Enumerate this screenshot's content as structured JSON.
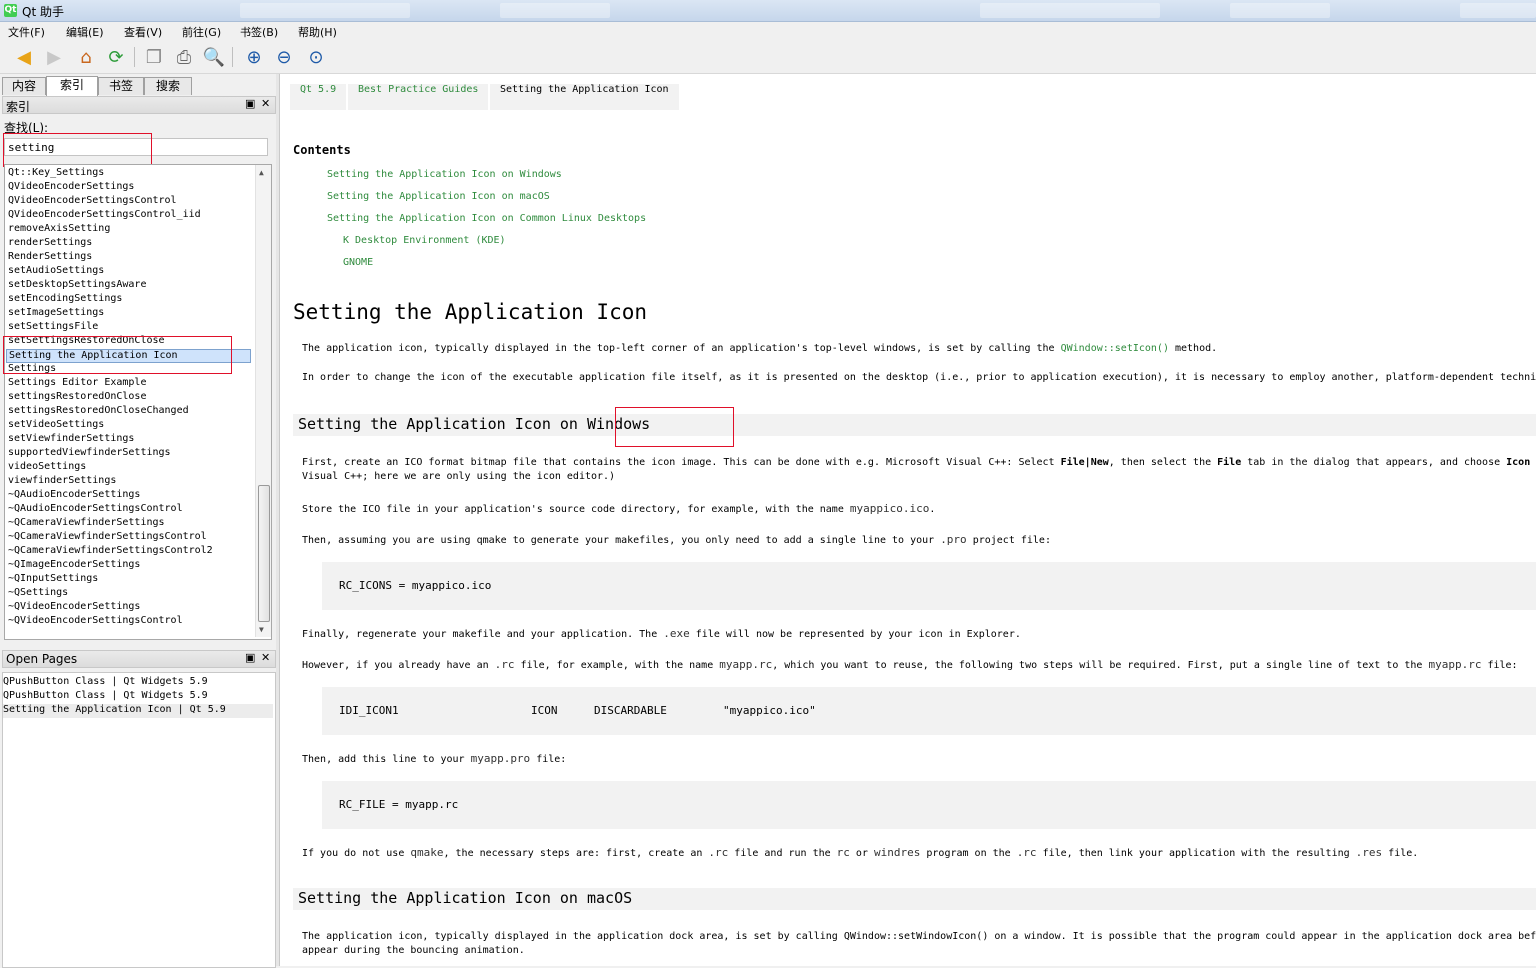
{
  "window": {
    "title": "Qt 助手",
    "app_icon": "qt-logo"
  },
  "menu": [
    "文件(F)",
    "编辑(E)",
    "查看(V)",
    "前往(G)",
    "书签(B)",
    "帮助(H)"
  ],
  "toolbar": [
    "back-icon",
    "forward-icon",
    "home-icon",
    "sync-icon",
    "copy-icon",
    "print-icon",
    "find-icon",
    "zoom-in-icon",
    "zoom-out-icon",
    "zoom-reset-icon"
  ],
  "left": {
    "tabs": [
      "内容",
      "索引",
      "书签",
      "搜索"
    ],
    "active_tab": "索引",
    "index_panel_title": "索引",
    "find_label": "查找(L):",
    "search_value": "setting",
    "index_items": [
      "Qt::Key_Settings",
      "QVideoEncoderSettings",
      "QVideoEncoderSettingsControl",
      "QVideoEncoderSettingsControl_iid",
      "removeAxisSetting",
      "renderSettings",
      "RenderSettings",
      "setAudioSettings",
      "setDesktopSettingsAware",
      "setEncodingSettings",
      "setImageSettings",
      "setSettingsFile",
      "setSettingsRestoredOnClose",
      "Setting the Application Icon",
      "Settings",
      "Settings Editor Example",
      "settingsRestoredOnClose",
      "settingsRestoredOnCloseChanged",
      "setVideoSettings",
      "setViewfinderSettings",
      "supportedViewfinderSettings",
      "videoSettings",
      "viewfinderSettings",
      "~QAudioEncoderSettings",
      "~QAudioEncoderSettingsControl",
      "~QCameraViewfinderSettings",
      "~QCameraViewfinderSettingsControl",
      "~QCameraViewfinderSettingsControl2",
      "~QImageEncoderSettings",
      "~QInputSettings",
      "~QSettings",
      "~QVideoEncoderSettings",
      "~QVideoEncoderSettingsControl"
    ],
    "selected_index": 13,
    "open_pages_title": "Open Pages",
    "open_pages": [
      "QPushButton Class | Qt Widgets 5.9",
      "QPushButton Class | Qt Widgets 5.9",
      "Setting the Application Icon | Qt 5.9"
    ]
  },
  "doc": {
    "breadcrumbs": [
      "Qt 5.9",
      "Best Practice Guides",
      "Setting the Application Icon"
    ],
    "contents_heading": "Contents",
    "toc": [
      "Setting the Application Icon on Windows",
      "Setting the Application Icon on macOS",
      "Setting the Application Icon on Common Linux Desktops",
      "K Desktop Environment (KDE)",
      "GNOME"
    ],
    "title": "Setting the Application Icon",
    "p1": {
      "a": "The application icon, typically displayed in the top-left corner of an application's top-level windows, is set by calling the ",
      "link": "QWindow::setIcon()",
      "b": " method."
    },
    "p2": "In order to change the icon of the executable application file itself, as it is presented on the desktop (i.e., prior to application execution), it is necessary to employ another, platform-dependent technique.",
    "h_windows": {
      "a": "Setting the Application Icon on ",
      "b": "Windows"
    },
    "p3": {
      "a": "First, create an ICO format bitmap file that contains the icon image. This can be done with e.g. Microsoft Visual C++: Select ",
      "b1": "File|New",
      "c": ", then select the ",
      "b2": "File",
      "d": " tab in the dialog that appears, and choose ",
      "b3": "Icon",
      "line2": "Visual C++; here we are only using the icon editor.)"
    },
    "p4": {
      "a": "Store the ICO file in your application's source code directory, for example, with the name ",
      "code": "myappico.ico",
      "b": "."
    },
    "p5": {
      "a": "Then, assuming you are using qmake to generate your makefiles, you only need to add a single line to your ",
      "code": ".pro",
      "b": " project file:"
    },
    "code1": "RC_ICONS = myappico.ico",
    "p6": {
      "a": "Finally, regenerate your makefile and your application. The ",
      "code": ".exe",
      "b": " file will now be represented by your icon in Explorer."
    },
    "p7": {
      "a": "However, if you already have an ",
      "code1": ".rc",
      "b": " file, for example, with the name ",
      "code2": "myapp.rc",
      "c": ", which you want to reuse, the following two steps will be required. First, put a single line of text to the ",
      "code3": "myapp.rc",
      "d": " file:"
    },
    "code2": [
      "IDI_ICON1",
      "ICON",
      "DISCARDABLE",
      "\"myappico.ico\""
    ],
    "p8": {
      "a": "Then, add this line to your ",
      "code": "myapp.pro",
      "b": " file:"
    },
    "code3": "RC_FILE = myapp.rc",
    "p9": {
      "a": "If you do not use ",
      "c1": "qmake",
      "b": ", the necessary steps are: first, create an ",
      "c2": ".rc",
      "c": " file and run the ",
      "c3": "rc",
      "d": " or ",
      "c4": "windres",
      "e": " program on the ",
      "c5": ".rc",
      "f": " file, then link your application with the resulting ",
      "c6": ".res",
      "g": " file."
    },
    "h_macos": "Setting the Application Icon on macOS",
    "p10": {
      "line1": "The application icon, typically displayed in the application dock area, is set by calling QWindow::setWindowIcon() on a window. It is possible that the program could appear in the application dock area before",
      "line2": "appear during the bouncing animation."
    }
  }
}
